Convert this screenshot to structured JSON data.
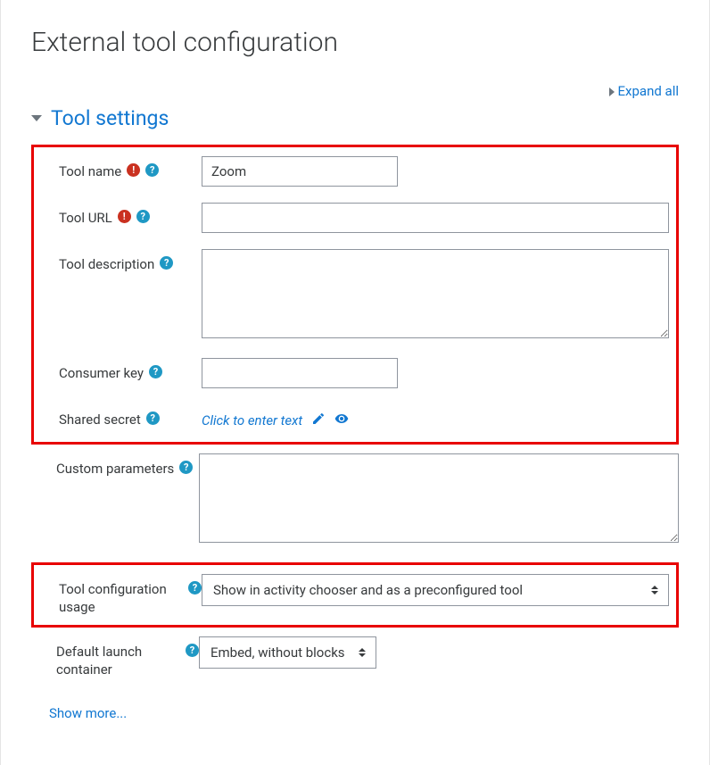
{
  "page_title": "External tool configuration",
  "expand_all": "Expand all",
  "section_title": "Tool settings",
  "fields": {
    "tool_name": {
      "label": "Tool name",
      "value": "Zoom"
    },
    "tool_url": {
      "label": "Tool URL",
      "value": ""
    },
    "tool_description": {
      "label": "Tool description",
      "value": ""
    },
    "consumer_key": {
      "label": "Consumer key",
      "value": ""
    },
    "shared_secret": {
      "label": "Shared secret",
      "placeholder": "Click to enter text"
    },
    "custom_parameters": {
      "label": "Custom parameters",
      "value": ""
    },
    "tool_config_usage": {
      "label": "Tool configuration usage",
      "value": "Show in activity chooser and as a preconfigured tool"
    },
    "default_launch": {
      "label": "Default launch container",
      "value": "Embed, without blocks"
    }
  },
  "show_more": "Show more..."
}
